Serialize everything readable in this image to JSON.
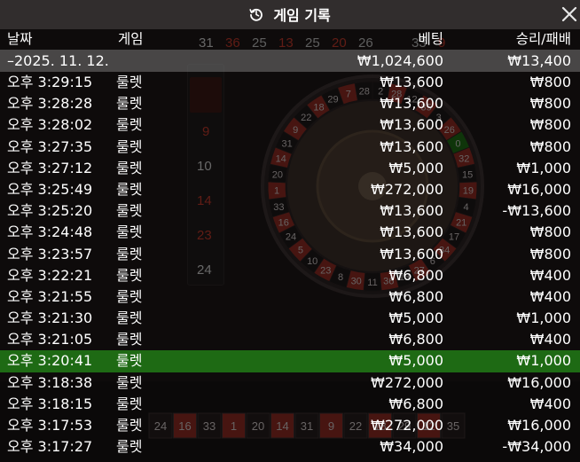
{
  "dialog": {
    "title": "게임 기록",
    "icon": "history-clock-icon",
    "close_icon": "close-icon",
    "columns": {
      "date": "날짜",
      "game": "게임",
      "bet": "베팅",
      "result": "승리/패배"
    },
    "date_group": {
      "date": "–2025. 11. 12.",
      "bet": "₩1,024,600",
      "result": "₩13,400"
    },
    "rows": [
      {
        "time": "오후 3:29:15",
        "game": "룰렛",
        "bet": "₩13,600",
        "result": "₩800"
      },
      {
        "time": "오후 3:28:28",
        "game": "룰렛",
        "bet": "₩13,600",
        "result": "₩800"
      },
      {
        "time": "오후 3:28:02",
        "game": "룰렛",
        "bet": "₩13,600",
        "result": "₩800"
      },
      {
        "time": "오후 3:27:35",
        "game": "룰렛",
        "bet": "₩13,600",
        "result": "₩800"
      },
      {
        "time": "오후 3:27:12",
        "game": "룰렛",
        "bet": "₩5,000",
        "result": "₩1,000"
      },
      {
        "time": "오후 3:25:49",
        "game": "룰렛",
        "bet": "₩272,000",
        "result": "₩16,000"
      },
      {
        "time": "오후 3:25:20",
        "game": "룰렛",
        "bet": "₩13,600",
        "result": "-₩13,600"
      },
      {
        "time": "오후 3:24:48",
        "game": "룰렛",
        "bet": "₩13,600",
        "result": "₩800"
      },
      {
        "time": "오후 3:23:57",
        "game": "룰렛",
        "bet": "₩13,600",
        "result": "₩800"
      },
      {
        "time": "오후 3:22:21",
        "game": "룰렛",
        "bet": "₩6,800",
        "result": "₩400"
      },
      {
        "time": "오후 3:21:55",
        "game": "룰렛",
        "bet": "₩6,800",
        "result": "₩400"
      },
      {
        "time": "오후 3:21:30",
        "game": "룰렛",
        "bet": "₩5,000",
        "result": "₩1,000"
      },
      {
        "time": "오후 3:21:05",
        "game": "룰렛",
        "bet": "₩6,800",
        "result": "₩400"
      },
      {
        "time": "오후 3:20:41",
        "game": "룰렛",
        "bet": "₩5,000",
        "result": "₩1,000",
        "selected": true
      },
      {
        "time": "오후 3:18:38",
        "game": "룰렛",
        "bet": "₩272,000",
        "result": "₩16,000"
      },
      {
        "time": "오후 3:18:15",
        "game": "룰렛",
        "bet": "₩6,800",
        "result": "₩400"
      },
      {
        "time": "오후 3:17:53",
        "game": "룰렛",
        "bet": "₩272,000",
        "result": "₩16,000"
      },
      {
        "time": "오후 3:17:27",
        "game": "룰렛",
        "bet": "₩34,000",
        "result": "-₩34,000"
      }
    ]
  },
  "background": {
    "recent_strip": [
      "31",
      "36",
      "25",
      "13",
      "25",
      "20",
      "26",
      "",
      "33",
      "9"
    ],
    "history_column": [
      "9",
      "10",
      "14",
      "23",
      "24"
    ],
    "history_colors": [
      "#c0392b",
      "#cfcfcf",
      "#c0392b",
      "#c0392b",
      "#cfcfcf"
    ],
    "wheel_numbers": [
      "2",
      "28",
      "12",
      "35",
      "3",
      "26",
      "0",
      "32",
      "15",
      "19",
      "4",
      "21",
      "17",
      "34",
      "6",
      "27",
      "13",
      "36",
      "11",
      "30",
      "8",
      "23",
      "10",
      "5",
      "24",
      "16",
      "33",
      "1",
      "20",
      "14",
      "31",
      "9",
      "22",
      "18",
      "29",
      "7",
      "28"
    ],
    "race_track": [
      "24",
      "16",
      "33",
      "1",
      "20",
      "14",
      "31",
      "9",
      "22",
      "18",
      "29",
      "12",
      "35"
    ],
    "colors": {
      "red": "#8e2a22",
      "black": "#1c1818",
      "green": "#1e6a14"
    }
  }
}
